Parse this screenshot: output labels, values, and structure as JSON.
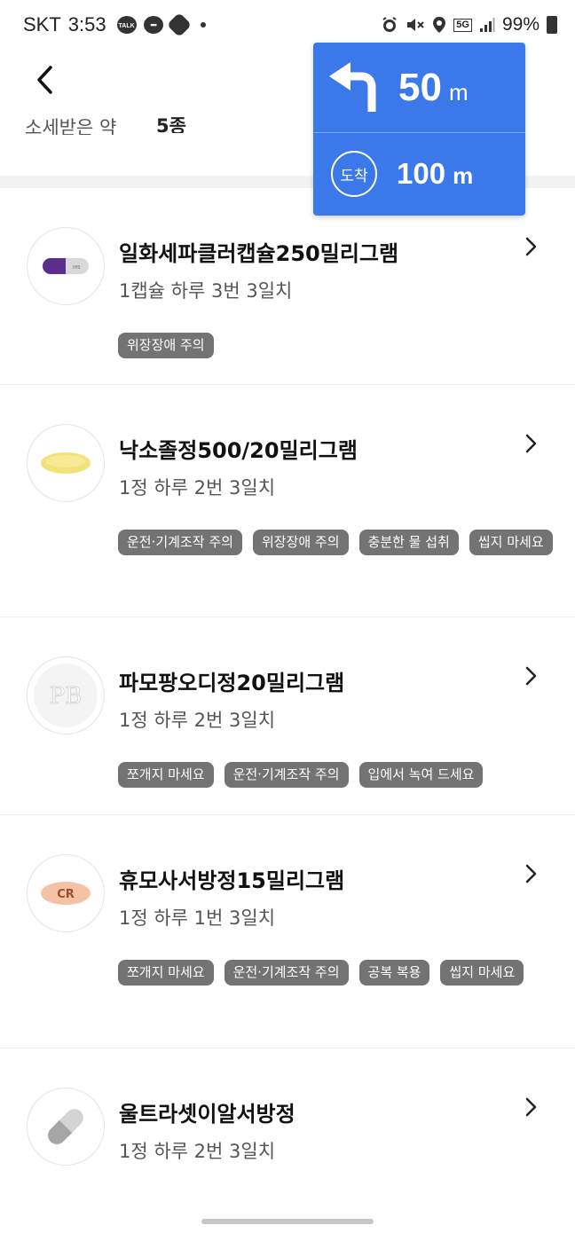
{
  "status_bar": {
    "carrier": "SKT",
    "time": "3:53",
    "talk_badge": "TALK",
    "network": "5G",
    "battery": "99%"
  },
  "header": {
    "summary_label": "소세받은 약",
    "summary_count": "5종"
  },
  "navigation_overlay": {
    "turn_distance": "50",
    "turn_unit": "m",
    "arrive_label": "도착",
    "arrive_distance": "100",
    "arrive_unit": "m"
  },
  "drugs": [
    {
      "name": "일화세파클러캡슐250밀리그램",
      "dose": "1캡슐 하루 3번 3일치",
      "pill_color": "#5b2d8c",
      "tags": [
        "위장장애 주의"
      ]
    },
    {
      "name": "낙소졸정500/20밀리그램",
      "dose": "1정 하루 2번 3일치",
      "pill_color": "#f2e27a",
      "tags": [
        "운전·기계조작 주의",
        "위장장애 주의",
        "충분한 물 섭취",
        "씹지 마세요"
      ]
    },
    {
      "name": "파모팡오디정20밀리그램",
      "dose": "1정 하루 2번 3일치",
      "pill_color": "#f5f5f5",
      "pill_imprint": "PB",
      "tags": [
        "쪼개지 마세요",
        "운전·기계조작 주의",
        "입에서 녹여 드세요"
      ]
    },
    {
      "name": "휴모사서방정15밀리그램",
      "dose": "1정 하루 1번 3일치",
      "pill_color": "#f6c2a6",
      "pill_imprint": "CR",
      "tags": [
        "쪼개지 마세요",
        "운전·기계조작 주의",
        "공복 복용",
        "씹지 마세요"
      ]
    },
    {
      "name": "울트라셋이알서방정",
      "dose": "1정 하루 2번 3일치",
      "tags": []
    }
  ]
}
